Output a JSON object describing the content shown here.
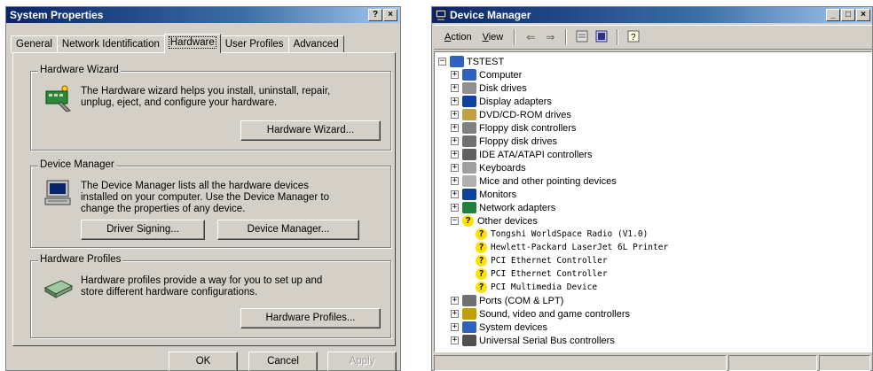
{
  "sysprops": {
    "title": "System Properties",
    "help_btn": "?",
    "close_btn": "×",
    "tabs": [
      "General",
      "Network Identification",
      "Hardware",
      "User Profiles",
      "Advanced"
    ],
    "active_tab": "Hardware",
    "groups": {
      "wizard": {
        "title": "Hardware Wizard",
        "text": "The Hardware wizard helps you install, uninstall, repair, unplug, eject, and configure your hardware.",
        "button": "Hardware Wizard..."
      },
      "devmgr": {
        "title": "Device Manager",
        "text": "The Device Manager lists all the hardware devices installed on your computer. Use the Device Manager to change the properties of any device.",
        "button_signing": "Driver Signing...",
        "button_devmgr": "Device Manager..."
      },
      "profiles": {
        "title": "Hardware Profiles",
        "text": "Hardware profiles provide a way for you to set up and store different hardware configurations.",
        "button": "Hardware Profiles..."
      }
    },
    "footer": {
      "ok": "OK",
      "cancel": "Cancel",
      "apply": "Apply"
    }
  },
  "devmgr": {
    "title": "Device Manager",
    "title_btns": {
      "min": "_",
      "max": "□",
      "close": "×"
    },
    "menu": {
      "action": "Action",
      "view": "View"
    },
    "toolbar_icons": [
      "back-icon",
      "forward-icon",
      "properties-icon",
      "scan-icon",
      "help-icon"
    ],
    "root": "TSTEST",
    "categories": [
      "Computer",
      "Disk drives",
      "Display adapters",
      "DVD/CD-ROM drives",
      "Floppy disk controllers",
      "Floppy disk drives",
      "IDE ATA/ATAPI controllers",
      "Keyboards",
      "Mice and other pointing devices",
      "Monitors",
      "Network adapters",
      "Other devices"
    ],
    "other_devices": [
      "Tongshi WorldSpace Radio (V1.0)",
      "Hewlett-Packard LaserJet 6L Printer",
      "PCI Ethernet Controller",
      "PCI Ethernet Controller",
      "PCI Multimedia Device"
    ],
    "categories_after": [
      "Ports (COM & LPT)",
      "Sound, video and game controllers",
      "System devices",
      "Universal Serial Bus controllers"
    ],
    "expand_symbol": "+",
    "collapse_symbol": "−"
  }
}
